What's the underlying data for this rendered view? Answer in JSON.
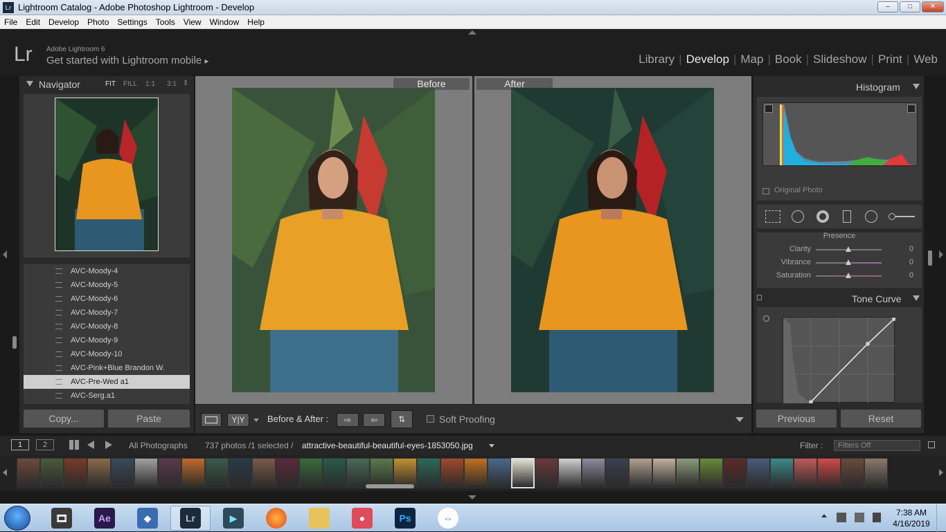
{
  "window": {
    "title": "Lightroom Catalog - Adobe Photoshop Lightroom - Develop",
    "app_icon": "Lr",
    "min": "–",
    "max": "□",
    "close": "✕"
  },
  "menu": [
    "File",
    "Edit",
    "Develop",
    "Photo",
    "Settings",
    "Tools",
    "View",
    "Window",
    "Help"
  ],
  "identity": {
    "logo": "Lr",
    "version": "Adobe Lightroom 6",
    "mobile": "Get started with Lightroom mobile",
    "mobile_arrow": "▸"
  },
  "modules": {
    "items": [
      "Library",
      "Develop",
      "Map",
      "Book",
      "Slideshow",
      "Print",
      "Web"
    ],
    "active": "Develop"
  },
  "navigator": {
    "title": "Navigator",
    "zoom": [
      "FIT",
      "FILL",
      "1:1",
      "3:1"
    ],
    "zoom_arrow": "⇕"
  },
  "presets": [
    "AVC-Moody-4",
    "AVC-Moody-5",
    "AVC-Moody-6",
    "AVC-Moody-7",
    "AVC-Moody-8",
    "AVC-Moody-9",
    "AVC-Moody-10",
    "AVC-Pink+Blue Brandon W.",
    "AVC-Pre-Wed a1",
    "AVC-Serg.a1"
  ],
  "presets_selected": "AVC-Pre-Wed a1",
  "left_buttons": {
    "copy": "Copy...",
    "paste": "Paste"
  },
  "before_after": {
    "before": "Before",
    "after": "After"
  },
  "toolbar": {
    "ba_label": "Before & After :",
    "soft_proofing": "Soft Proofing",
    "view_yy": "Y|Y"
  },
  "histogram": {
    "title": "Histogram",
    "original_photo": "Original Photo"
  },
  "presence": {
    "title": "Presence",
    "sliders": [
      {
        "label": "Clarity",
        "value": "0",
        "pos": 0.5
      },
      {
        "label": "Vibrance",
        "value": "0",
        "pos": 0.5
      },
      {
        "label": "Saturation",
        "value": "0",
        "pos": 0.5
      }
    ]
  },
  "tone_curve": {
    "title": "Tone Curve"
  },
  "right_buttons": {
    "previous": "Previous",
    "reset": "Reset"
  },
  "filmbar": {
    "page1": "1",
    "page2": "2",
    "source": "All Photographs",
    "count": "737 photos /1 selected /",
    "filename": "attractive-beautiful-beautiful-eyes-1853050.jpg",
    "filter_label": "Filter :",
    "filter_value": "Filters Off"
  },
  "taskbar": {
    "time": "7:38 AM",
    "date": "4/16/2019",
    "apps": [
      "Ae",
      "Lr",
      "Ps"
    ]
  },
  "colors": {
    "shirt": "#e8961f",
    "jeans": "#2f5a73",
    "foliage": "#2c4a2a"
  }
}
